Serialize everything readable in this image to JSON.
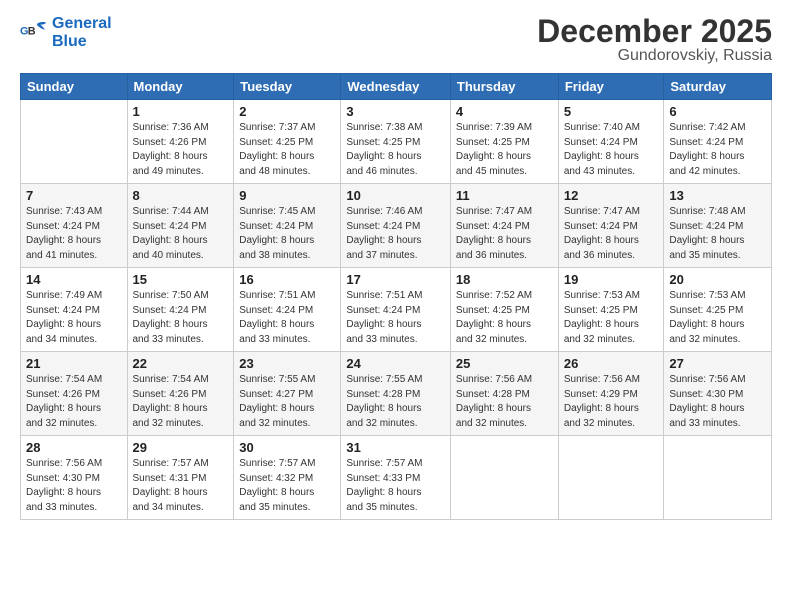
{
  "logo": {
    "line1": "General",
    "line2": "Blue"
  },
  "title": "December 2025",
  "subtitle": "Gundorovskiy, Russia",
  "header_days": [
    "Sunday",
    "Monday",
    "Tuesday",
    "Wednesday",
    "Thursday",
    "Friday",
    "Saturday"
  ],
  "weeks": [
    [
      {
        "day": "",
        "info": ""
      },
      {
        "day": "1",
        "info": "Sunrise: 7:36 AM\nSunset: 4:26 PM\nDaylight: 8 hours\nand 49 minutes."
      },
      {
        "day": "2",
        "info": "Sunrise: 7:37 AM\nSunset: 4:25 PM\nDaylight: 8 hours\nand 48 minutes."
      },
      {
        "day": "3",
        "info": "Sunrise: 7:38 AM\nSunset: 4:25 PM\nDaylight: 8 hours\nand 46 minutes."
      },
      {
        "day": "4",
        "info": "Sunrise: 7:39 AM\nSunset: 4:25 PM\nDaylight: 8 hours\nand 45 minutes."
      },
      {
        "day": "5",
        "info": "Sunrise: 7:40 AM\nSunset: 4:24 PM\nDaylight: 8 hours\nand 43 minutes."
      },
      {
        "day": "6",
        "info": "Sunrise: 7:42 AM\nSunset: 4:24 PM\nDaylight: 8 hours\nand 42 minutes."
      }
    ],
    [
      {
        "day": "7",
        "info": "Sunrise: 7:43 AM\nSunset: 4:24 PM\nDaylight: 8 hours\nand 41 minutes."
      },
      {
        "day": "8",
        "info": "Sunrise: 7:44 AM\nSunset: 4:24 PM\nDaylight: 8 hours\nand 40 minutes."
      },
      {
        "day": "9",
        "info": "Sunrise: 7:45 AM\nSunset: 4:24 PM\nDaylight: 8 hours\nand 38 minutes."
      },
      {
        "day": "10",
        "info": "Sunrise: 7:46 AM\nSunset: 4:24 PM\nDaylight: 8 hours\nand 37 minutes."
      },
      {
        "day": "11",
        "info": "Sunrise: 7:47 AM\nSunset: 4:24 PM\nDaylight: 8 hours\nand 36 minutes."
      },
      {
        "day": "12",
        "info": "Sunrise: 7:47 AM\nSunset: 4:24 PM\nDaylight: 8 hours\nand 36 minutes."
      },
      {
        "day": "13",
        "info": "Sunrise: 7:48 AM\nSunset: 4:24 PM\nDaylight: 8 hours\nand 35 minutes."
      }
    ],
    [
      {
        "day": "14",
        "info": "Sunrise: 7:49 AM\nSunset: 4:24 PM\nDaylight: 8 hours\nand 34 minutes."
      },
      {
        "day": "15",
        "info": "Sunrise: 7:50 AM\nSunset: 4:24 PM\nDaylight: 8 hours\nand 33 minutes."
      },
      {
        "day": "16",
        "info": "Sunrise: 7:51 AM\nSunset: 4:24 PM\nDaylight: 8 hours\nand 33 minutes."
      },
      {
        "day": "17",
        "info": "Sunrise: 7:51 AM\nSunset: 4:24 PM\nDaylight: 8 hours\nand 33 minutes."
      },
      {
        "day": "18",
        "info": "Sunrise: 7:52 AM\nSunset: 4:25 PM\nDaylight: 8 hours\nand 32 minutes."
      },
      {
        "day": "19",
        "info": "Sunrise: 7:53 AM\nSunset: 4:25 PM\nDaylight: 8 hours\nand 32 minutes."
      },
      {
        "day": "20",
        "info": "Sunrise: 7:53 AM\nSunset: 4:25 PM\nDaylight: 8 hours\nand 32 minutes."
      }
    ],
    [
      {
        "day": "21",
        "info": "Sunrise: 7:54 AM\nSunset: 4:26 PM\nDaylight: 8 hours\nand 32 minutes."
      },
      {
        "day": "22",
        "info": "Sunrise: 7:54 AM\nSunset: 4:26 PM\nDaylight: 8 hours\nand 32 minutes."
      },
      {
        "day": "23",
        "info": "Sunrise: 7:55 AM\nSunset: 4:27 PM\nDaylight: 8 hours\nand 32 minutes."
      },
      {
        "day": "24",
        "info": "Sunrise: 7:55 AM\nSunset: 4:28 PM\nDaylight: 8 hours\nand 32 minutes."
      },
      {
        "day": "25",
        "info": "Sunrise: 7:56 AM\nSunset: 4:28 PM\nDaylight: 8 hours\nand 32 minutes."
      },
      {
        "day": "26",
        "info": "Sunrise: 7:56 AM\nSunset: 4:29 PM\nDaylight: 8 hours\nand 32 minutes."
      },
      {
        "day": "27",
        "info": "Sunrise: 7:56 AM\nSunset: 4:30 PM\nDaylight: 8 hours\nand 33 minutes."
      }
    ],
    [
      {
        "day": "28",
        "info": "Sunrise: 7:56 AM\nSunset: 4:30 PM\nDaylight: 8 hours\nand 33 minutes."
      },
      {
        "day": "29",
        "info": "Sunrise: 7:57 AM\nSunset: 4:31 PM\nDaylight: 8 hours\nand 34 minutes."
      },
      {
        "day": "30",
        "info": "Sunrise: 7:57 AM\nSunset: 4:32 PM\nDaylight: 8 hours\nand 35 minutes."
      },
      {
        "day": "31",
        "info": "Sunrise: 7:57 AM\nSunset: 4:33 PM\nDaylight: 8 hours\nand 35 minutes."
      },
      {
        "day": "",
        "info": ""
      },
      {
        "day": "",
        "info": ""
      },
      {
        "day": "",
        "info": ""
      }
    ]
  ]
}
